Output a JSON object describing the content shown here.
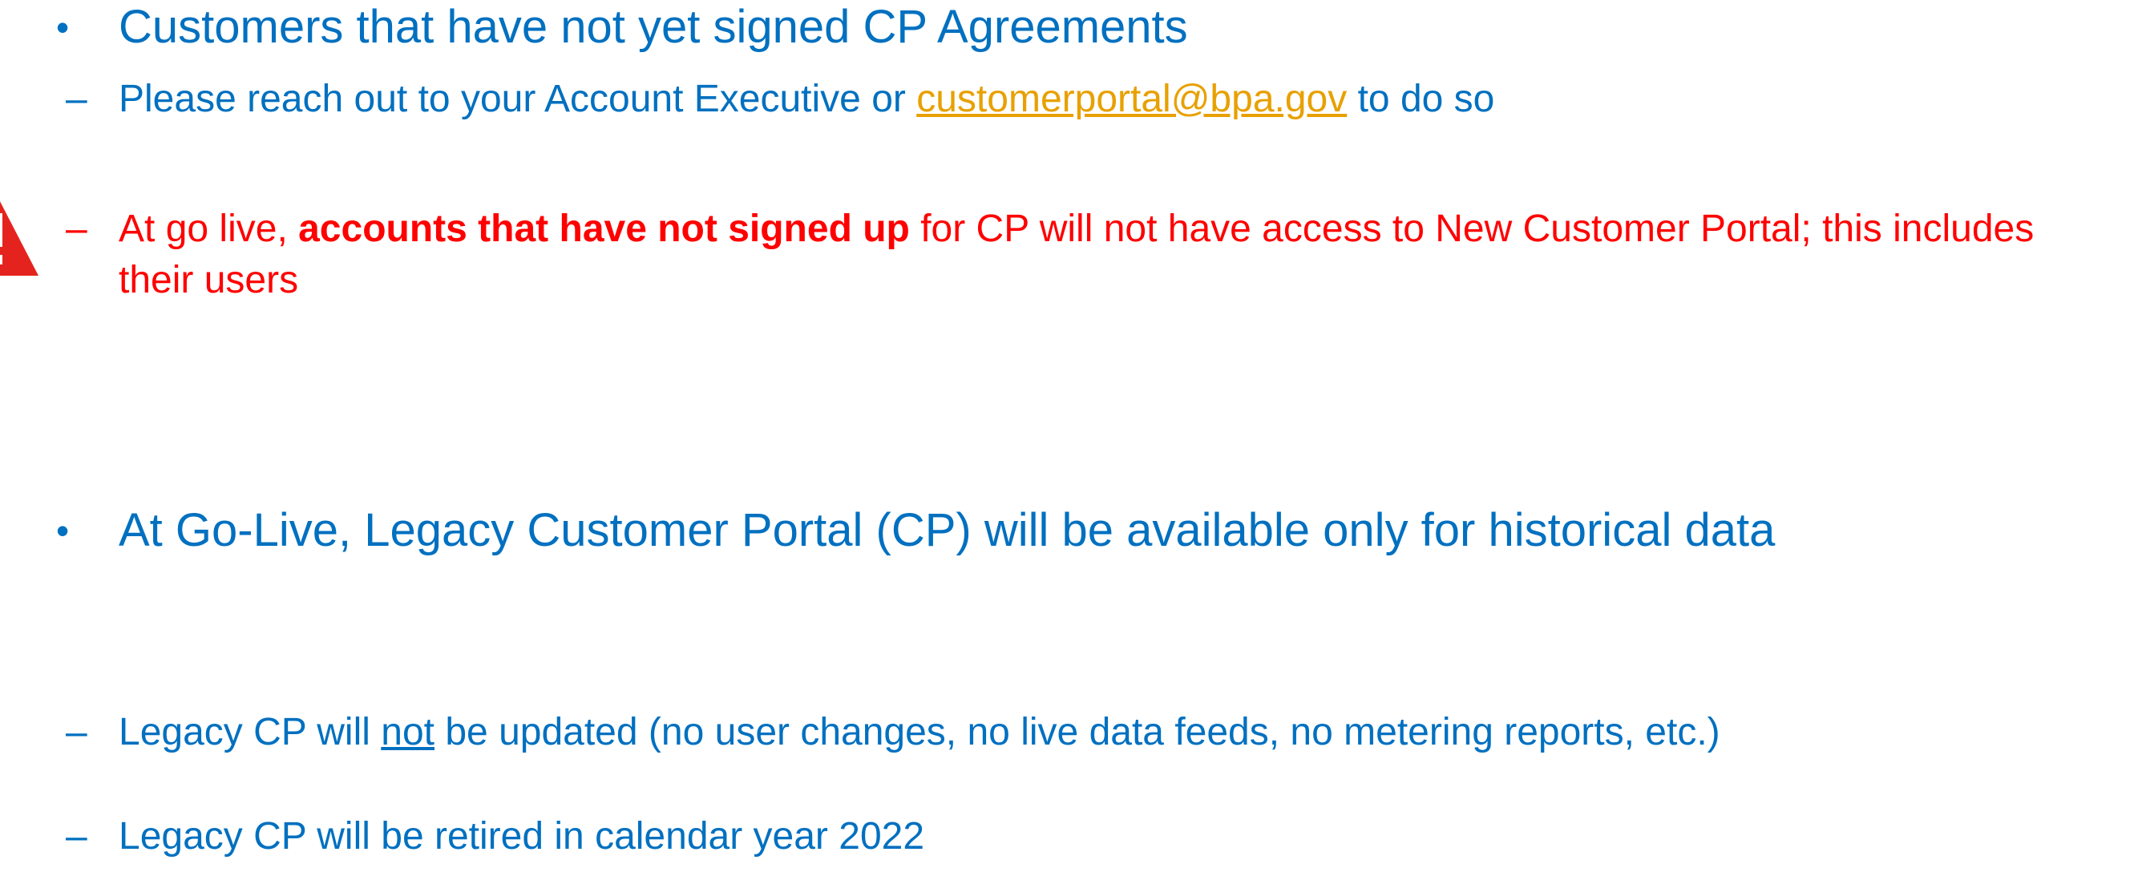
{
  "colors": {
    "text_blue": "#0070c0",
    "warning_red": "#ff0000",
    "link_orange": "#e8a000",
    "triangle_red": "#e5231e"
  },
  "bullet1": {
    "marker": "•",
    "text": "Customers that have not yet signed CP Agreements",
    "sub1": {
      "dash": "–",
      "before_link": "Please reach out to your Account Executive or ",
      "link": "customerportal@bpa.gov",
      "after_link": " to do so"
    },
    "sub2": {
      "dash": "–",
      "before_bold": "At go live, ",
      "bold": "accounts that have not signed up",
      "after_bold": " for CP will not have access to New Customer Portal; this includes their users"
    }
  },
  "bullet2": {
    "marker": "•",
    "text": "At Go-Live, Legacy Customer Portal (CP) will be available only for historical data",
    "sub1": {
      "dash": "–",
      "before_u": "Legacy CP will ",
      "underlined": "not",
      "after_u": " be updated (no user changes, no live data feeds, no metering reports, etc.)"
    },
    "sub2": {
      "dash": "–",
      "text": "Legacy CP will be retired in calendar year 2022"
    }
  },
  "warning_icon": "warning-triangle-icon"
}
